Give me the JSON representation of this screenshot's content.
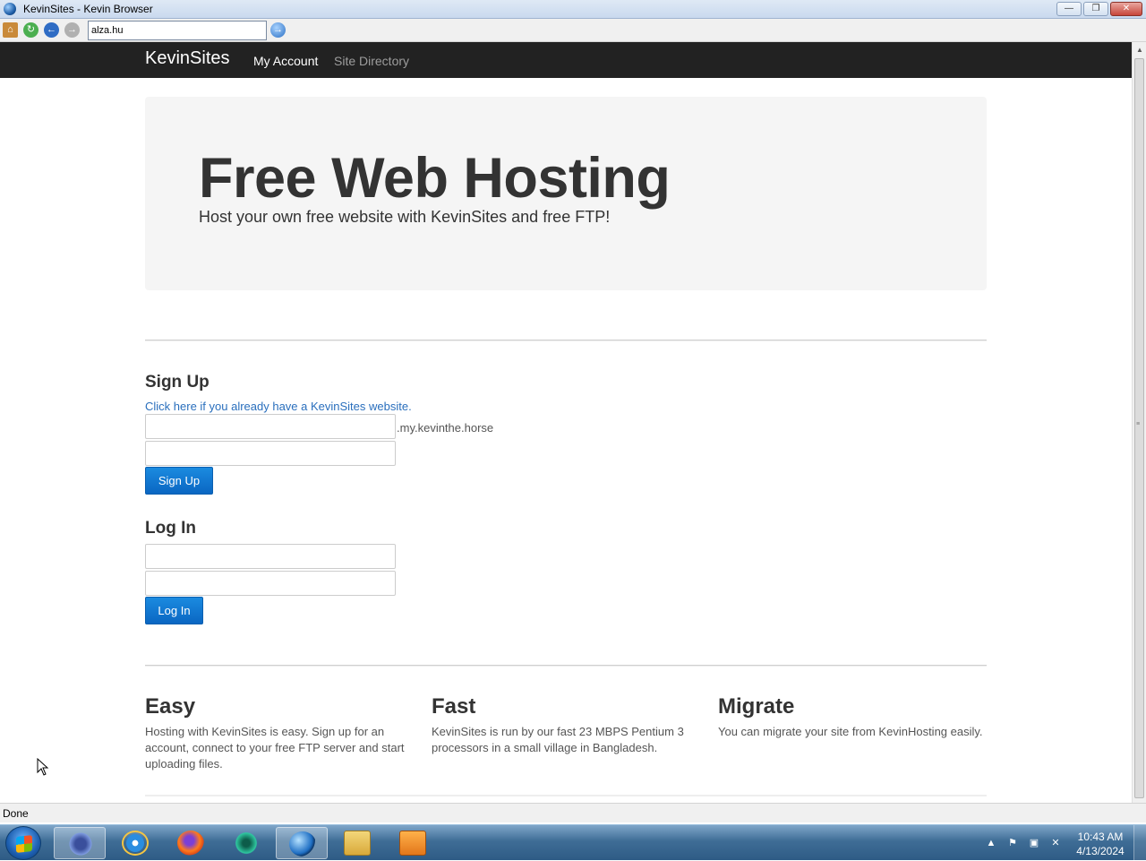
{
  "window": {
    "title": "KevinSites - Kevin Browser",
    "controls": {
      "minimize": "—",
      "maximize": "❐",
      "close": "✕"
    }
  },
  "toolbar": {
    "address_value": "alza.hu",
    "icons": [
      "home-icon",
      "refresh-icon",
      "back-icon",
      "forward-icon",
      "go-icon"
    ]
  },
  "navbar": {
    "brand": "KevinSites",
    "links": [
      "My Account",
      "Site Directory"
    ]
  },
  "jumbotron": {
    "heading": "Free Web Hosting",
    "subheading": "Host your own free website with KevinSites and free FTP!"
  },
  "signup": {
    "heading": "Sign Up",
    "existing_link": "Click here if you already have a KevinSites website.",
    "domain_suffix": ".my.kevinthe.horse",
    "button": "Sign Up"
  },
  "login": {
    "heading": "Log In",
    "button": "Log In"
  },
  "features": [
    {
      "title": "Easy",
      "text": "Hosting with KevinSites is easy. Sign up for an account, connect to your free FTP server and start uploading files."
    },
    {
      "title": "Fast",
      "text": "KevinSites is run by our fast 23 MBPS Pentium 3 processors in a small village in Bangladesh."
    },
    {
      "title": "Migrate",
      "text": "You can migrate your site from KevinHosting easily."
    }
  ],
  "statusbar": {
    "text": "Done"
  },
  "taskbar": {
    "apps": [
      "kevin-app-icon",
      "internet-explorer-icon",
      "firefox-icon",
      "chat-icon",
      "kevin-browser-icon",
      "file-explorer-icon",
      "media-player-icon"
    ],
    "active_index": 4,
    "clock_time": "10:43 AM",
    "clock_date": "4/13/2024"
  }
}
